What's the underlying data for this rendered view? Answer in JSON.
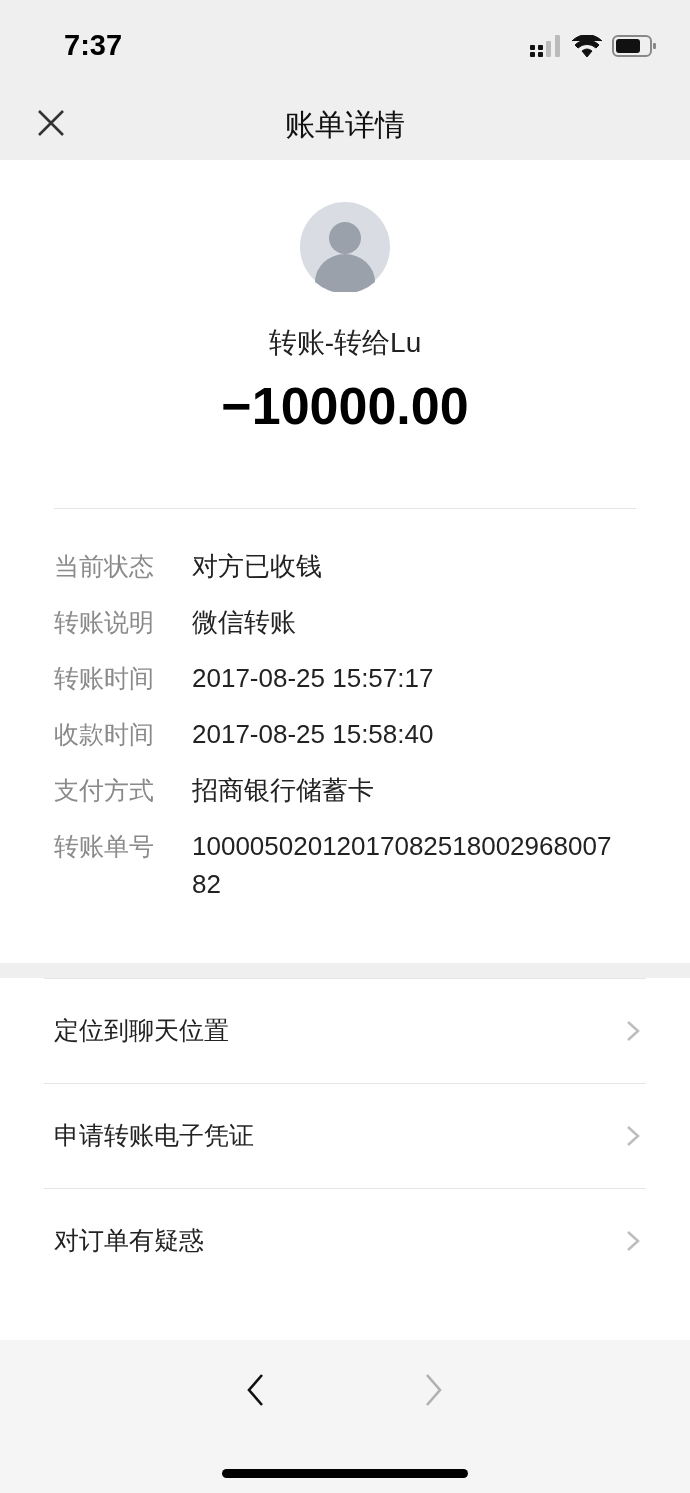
{
  "status_bar": {
    "time": "7:37"
  },
  "nav": {
    "title": "账单详情"
  },
  "summary": {
    "name": "转账-转给Lu",
    "amount": "−10000.00"
  },
  "details": [
    {
      "label": "当前状态",
      "value": "对方已收钱"
    },
    {
      "label": "转账说明",
      "value": "微信转账"
    },
    {
      "label": "转账时间",
      "value": "2017-08-25 15:57:17"
    },
    {
      "label": "收款时间",
      "value": "2017-08-25 15:58:40"
    },
    {
      "label": "支付方式",
      "value": "招商银行储蓄卡"
    },
    {
      "label": "转账单号",
      "value": "1000050201201708251800296800782"
    }
  ],
  "menu": [
    {
      "label": "定位到聊天位置"
    },
    {
      "label": "申请转账电子凭证"
    },
    {
      "label": "对订单有疑惑"
    }
  ],
  "toolbar": {
    "back": {
      "disabled": false
    },
    "forward": {
      "disabled": true
    }
  }
}
